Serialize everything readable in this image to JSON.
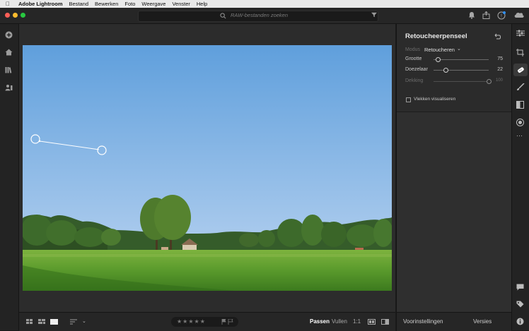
{
  "menubar": {
    "items": [
      "Adobe Lightroom",
      "Bestand",
      "Bewerken",
      "Foto",
      "Weergave",
      "Venster",
      "Help"
    ]
  },
  "titlebar": {
    "search_placeholder": "RAW-bestanden zoeken"
  },
  "icons": {
    "left_rail": [
      "add-photos-icon",
      "home-icon",
      "library-icon",
      "people-icon"
    ],
    "right_rail": [
      "edit-sliders-icon",
      "crop-icon",
      "healing-brush-icon",
      "brush-icon",
      "linear-gradient-icon",
      "radial-gradient-icon",
      "more-icon",
      "comments-icon",
      "keywords-icon",
      "info-icon"
    ],
    "top_right": [
      "notifications-icon",
      "share-icon",
      "help-icon",
      "cloud-sync-icon"
    ]
  },
  "panel": {
    "title": "Retoucheerpenseel",
    "mode_label": "Modus",
    "mode_value": "Retoucheren",
    "size_label": "Grootte",
    "size_value": "75",
    "size_fraction": 0.08,
    "feather_label": "Doezelaar",
    "feather_value": "22",
    "feather_fraction": 0.22,
    "opacity_label": "Dekking",
    "opacity_value": "100",
    "opacity_fraction": 1.0,
    "visualize_label": "Vlekken visualiseren",
    "visualize_checked": false
  },
  "bottombar": {
    "stars": "★★★★★",
    "fit_label": "Passen",
    "fill_label": "Vullen",
    "ratio_label": "1:1"
  },
  "panel_bottom": {
    "presets_label": "Voorinstellingen",
    "versions_label": "Versies"
  },
  "colors": {
    "accent": "#ffffff",
    "sky_top": "#5f9fdc",
    "sky_bottom": "#b9d2ea",
    "grass": "#5a9a2c"
  }
}
